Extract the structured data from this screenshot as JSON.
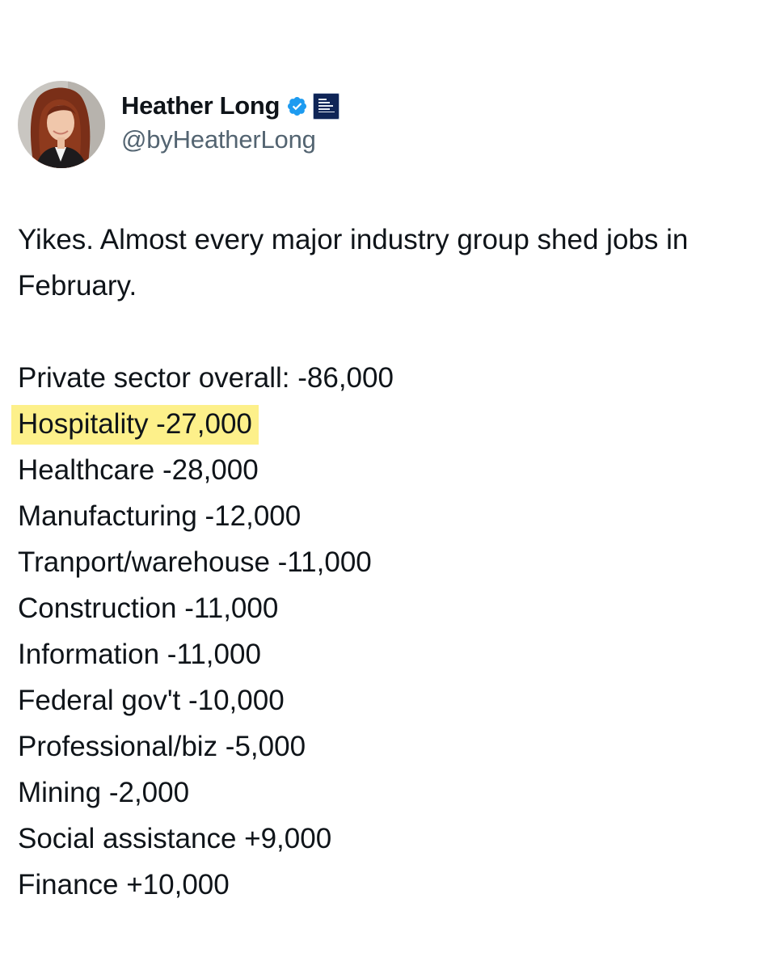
{
  "author": {
    "display_name": "Heather Long",
    "handle": "@byHeatherLong",
    "verified_icon": "verified-badge-icon",
    "affiliate_badge_icon": "newspaper-affiliate-icon",
    "avatar": "profile-photo"
  },
  "tweet": {
    "intro": "Yikes. Almost every major industry group shed jobs in February.",
    "lines": [
      {
        "text": "Private sector overall: -86,000",
        "highlighted": false
      },
      {
        "text": "Hospitality -27,000",
        "highlighted": true
      },
      {
        "text": "Healthcare -28,000",
        "highlighted": false
      },
      {
        "text": "Manufacturing -12,000",
        "highlighted": false
      },
      {
        "text": "Tranport/warehouse -11,000",
        "highlighted": false
      },
      {
        "text": "Construction -11,000",
        "highlighted": false
      },
      {
        "text": "Information -11,000",
        "highlighted": false
      },
      {
        "text": "Federal gov't -10,000",
        "highlighted": false
      },
      {
        "text": "Professional/biz -5,000",
        "highlighted": false
      },
      {
        "text": "Mining -2,000",
        "highlighted": false
      },
      {
        "text": "Social assistance +9,000",
        "highlighted": false
      },
      {
        "text": "Finance +10,000",
        "highlighted": false
      }
    ]
  },
  "colors": {
    "text": "#0f1419",
    "handle": "#536471",
    "verified": "#1d9bf0",
    "highlight": "#fdf08a",
    "badge": "#0f2557"
  }
}
